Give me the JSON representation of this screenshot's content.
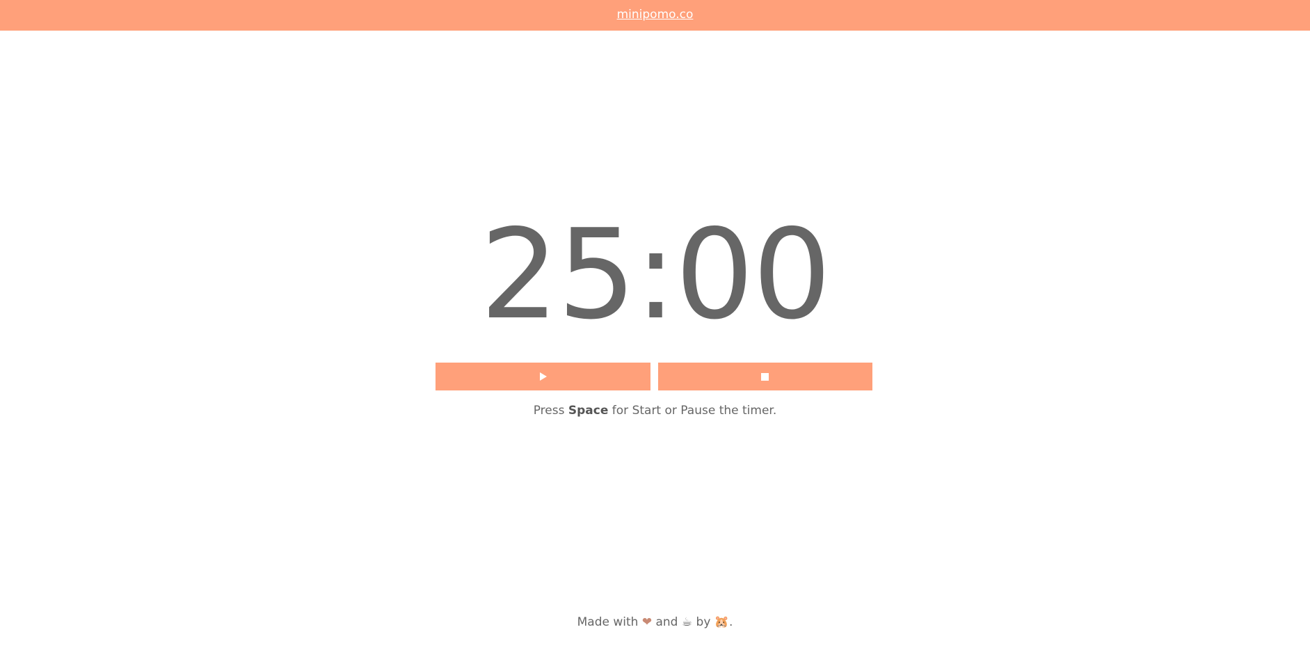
{
  "header": {
    "site_link": "minipomo.co",
    "background_color": "#ffa07a"
  },
  "timer": {
    "display": "25:00"
  },
  "controls": {
    "play_icon": "play-icon",
    "stop_icon": "stop-icon"
  },
  "hint": {
    "prefix": "Press ",
    "key": "Space",
    "suffix": " for Start or Pause the timer."
  },
  "footer": {
    "made_with": "Made with ",
    "heart": "❤",
    "and": " and ",
    "coffee": "☕",
    "by": " by ",
    "hamster": "🐹",
    "end": "."
  }
}
